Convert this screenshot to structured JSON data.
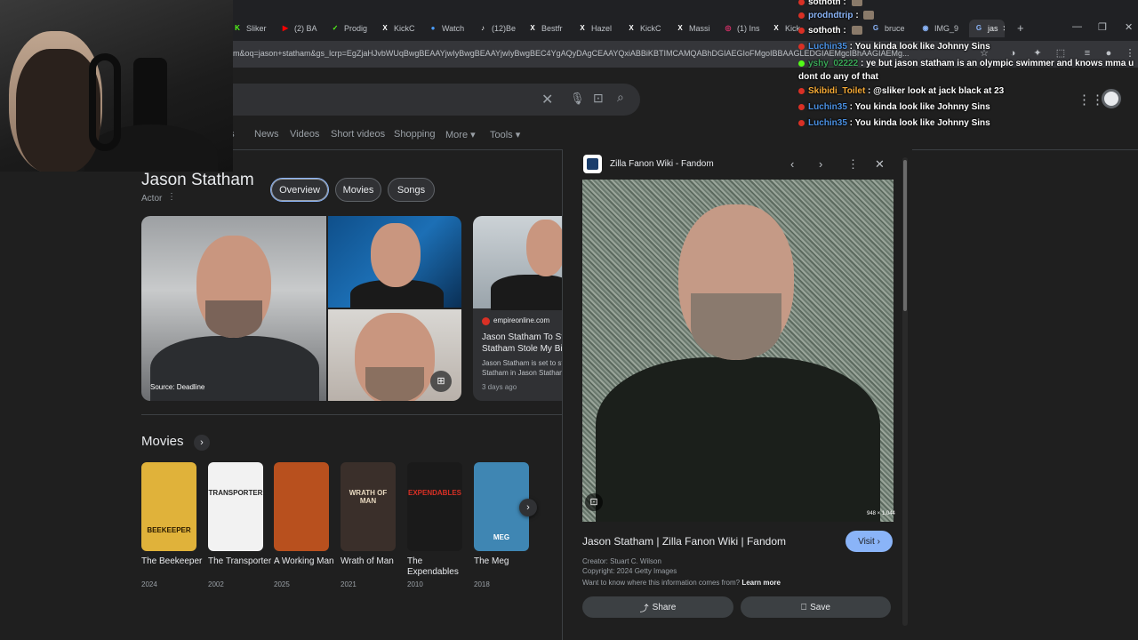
{
  "browser": {
    "tabs": [
      {
        "label": "Sliker",
        "color": "#53fc18",
        "glyph": "K"
      },
      {
        "label": "(2) BA",
        "color": "#ff0000",
        "glyph": "▶"
      },
      {
        "label": "Prodig",
        "color": "#53fc18",
        "glyph": "✓"
      },
      {
        "label": "KickC",
        "color": "#ffffff",
        "glyph": "X"
      },
      {
        "label": "Watch",
        "color": "#4a9eff",
        "glyph": "●"
      },
      {
        "label": "(12)Be",
        "color": "#ffffff",
        "glyph": "♪"
      },
      {
        "label": "Bestfr",
        "color": "#ffffff",
        "glyph": "X"
      },
      {
        "label": "Hazel",
        "color": "#ffffff",
        "glyph": "X"
      },
      {
        "label": "KickC",
        "color": "#ffffff",
        "glyph": "X"
      },
      {
        "label": "Massi",
        "color": "#ffffff",
        "glyph": "X"
      },
      {
        "label": "(1) Ins",
        "color": "#e1306c",
        "glyph": "◎"
      },
      {
        "label": "Kick",
        "color": "#ffffff",
        "glyph": "X"
      },
      {
        "label": "bruce",
        "color": "#8ab4f8",
        "glyph": "G"
      },
      {
        "label": "IMG_9",
        "color": "#8ab4f8",
        "glyph": "◉"
      },
      {
        "label": "jas",
        "color": "#8ab4f8",
        "glyph": "G"
      }
    ],
    "url": "m&oq=jason+statham&gs_lcrp=EgZjaHJvbWUqBwgBEAAYjwIyBwgBEAAYjwIyBwgBEC4YgAQyDAgCEAAYQxiABBiKBTIMCAMQABhDGIAEGIoFMgoIBBAAGLEDGIAEMgcIBhAAGIAEMg..."
  },
  "search": {
    "nav_tabs": [
      "es",
      "News",
      "Videos",
      "Short videos",
      "Shopping",
      "More",
      "Tools"
    ]
  },
  "knowledge_panel": {
    "title": "Jason Statham",
    "subtitle": "Actor",
    "chips": [
      "Overview",
      "Movies",
      "Songs"
    ],
    "photo_source": "Source: Deadline",
    "news": {
      "source": "empireonline.com",
      "title": "Jason Statham To Star In Statham Stole My Bike -",
      "snippet": "Jason Statham is set to star a Statham in Jason Statham St",
      "time": "3 days ago"
    }
  },
  "movies": {
    "heading": "Movies",
    "items": [
      {
        "title": "The Beekeeper",
        "year": "2024",
        "poster_color": "#e0b23a",
        "poster_text": "BEEKEEPER",
        "text_color": "#2a1a00"
      },
      {
        "title": "The Transporter",
        "year": "2002",
        "poster_color": "#f2f2f2",
        "poster_text": "TRANSPORTER",
        "text_color": "#222222"
      },
      {
        "title": "A Working Man",
        "year": "2025",
        "poster_color": "#b8501e",
        "poster_text": "",
        "text_color": "#ffffff"
      },
      {
        "title": "Wrath of Man",
        "year": "2021",
        "poster_color": "#3a2f2a",
        "poster_text": "WRATH OF MAN",
        "text_color": "#e8d9c0"
      },
      {
        "title": "The Expendables",
        "year": "2010",
        "poster_color": "#1a1a1a",
        "poster_text": "EXPENDABLES",
        "text_color": "#d93025"
      },
      {
        "title": "The Meg",
        "year": "2018",
        "poster_color": "#3f86b3",
        "poster_text": "MEG",
        "text_color": "#ffffff"
      }
    ]
  },
  "viewer": {
    "site": "Zilla Fanon Wiki - Fandom",
    "title": "Jason Statham | Zilla Fanon Wiki | Fandom",
    "visit_label": "Visit",
    "dims": "948 × 1,044",
    "creator": "Creator: Stuart C. Wilson",
    "copyright": "Copyright: 2024 Getty Images",
    "info_text": "Want to know where this information comes from?",
    "learn_more": "Learn more",
    "share_label": "Share",
    "save_label": "Save"
  },
  "chat": {
    "messages": [
      {
        "user": "sothoth",
        "text": "",
        "color": "#ffffff",
        "badge": "#d93025"
      },
      {
        "user": "prodndtrip",
        "text": "",
        "color": "#8ab4f8",
        "badge": "#d93025"
      },
      {
        "user": "sothoth",
        "text": "",
        "color": "#ffffff",
        "badge": "#d93025"
      },
      {
        "user": "Luchin35",
        "text": "You kinda look like Johnny Sins",
        "color": "#4a90e2",
        "badge": "#d93025"
      },
      {
        "user": "yshy_02222",
        "text": "ye but jason statham is an olympic swimmer and knows mma u dont do any of that",
        "color": "#3aa757",
        "badge": "#53fc18"
      },
      {
        "user": "Skibidi_Toilet",
        "text": "@sliker look at jack black at 23",
        "color": "#f4a935",
        "badge": "#d93025"
      },
      {
        "user": "Luchin35",
        "text": "You kinda look like Johnny Sins",
        "color": "#4a90e2",
        "badge": "#d93025"
      },
      {
        "user": "Luchin35",
        "text": "You kinda look like Johnny Sins",
        "color": "#4a90e2",
        "badge": "#d93025"
      }
    ]
  }
}
